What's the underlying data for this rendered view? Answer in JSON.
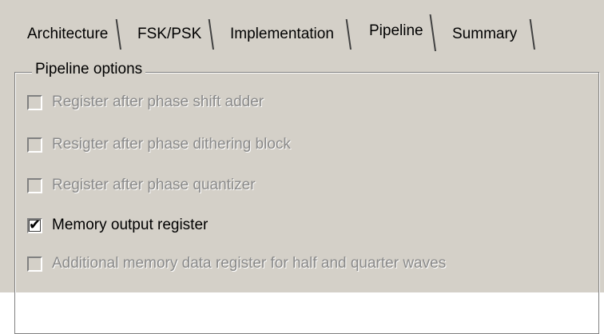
{
  "tabs": [
    {
      "label": "Architecture",
      "selected": false
    },
    {
      "label": "FSK/PSK",
      "selected": false
    },
    {
      "label": "Implementation",
      "selected": false
    },
    {
      "label": "Pipeline",
      "selected": true
    },
    {
      "label": "Summary",
      "selected": false
    }
  ],
  "group": {
    "title": "Pipeline options",
    "options": [
      {
        "label": "Register after phase shift adder",
        "checked": false,
        "enabled": false
      },
      {
        "label": "Resigter after phase dithering block",
        "checked": false,
        "enabled": false
      },
      {
        "label": "Register after phase quantizer",
        "checked": false,
        "enabled": false
      },
      {
        "label": "Memory output register",
        "checked": true,
        "enabled": true
      },
      {
        "label": "Additional memory data register for half and quarter waves",
        "checked": false,
        "enabled": false
      }
    ]
  },
  "icons": {
    "check": "checkmark-icon"
  },
  "colors": {
    "face": "#d4d0c8",
    "disabled_text": "#8a8a8a"
  }
}
